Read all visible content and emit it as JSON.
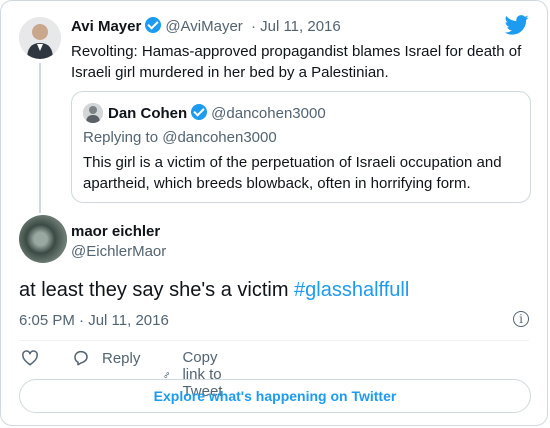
{
  "colors": {
    "accent": "#1d9bf0",
    "secondary_text": "#536471",
    "border": "#cfd9de"
  },
  "parent": {
    "name": "Avi Mayer",
    "handle": "@AviMayer",
    "date": "· Jul 11, 2016",
    "text": "Revolting: Hamas-approved propagandist blames Israel for death of Israeli girl murdered in her bed by a Palestinian."
  },
  "quote": {
    "name": "Dan Cohen",
    "handle": "@dancohen3000",
    "replying_to": "Replying to @dancohen3000",
    "text": "This girl is a victim of the perpetuation of Israeli occupation and apartheid, which breeds blowback, often in horrifying form."
  },
  "tweet": {
    "name": "maor eichler",
    "handle": "@EichlerMaor",
    "text": "at least they say she's a victim ",
    "hashtag": "#glasshalffull",
    "timestamp": "6:05 PM · Jul 11, 2016"
  },
  "actions": {
    "reply_label": "Reply",
    "copy_label": "Copy link to Tweet"
  },
  "explore_label": "Explore what's happening on Twitter",
  "icons": [
    "twitter-bird-icon",
    "verified-icon",
    "heart-icon",
    "reply-icon",
    "link-icon",
    "info-icon"
  ]
}
